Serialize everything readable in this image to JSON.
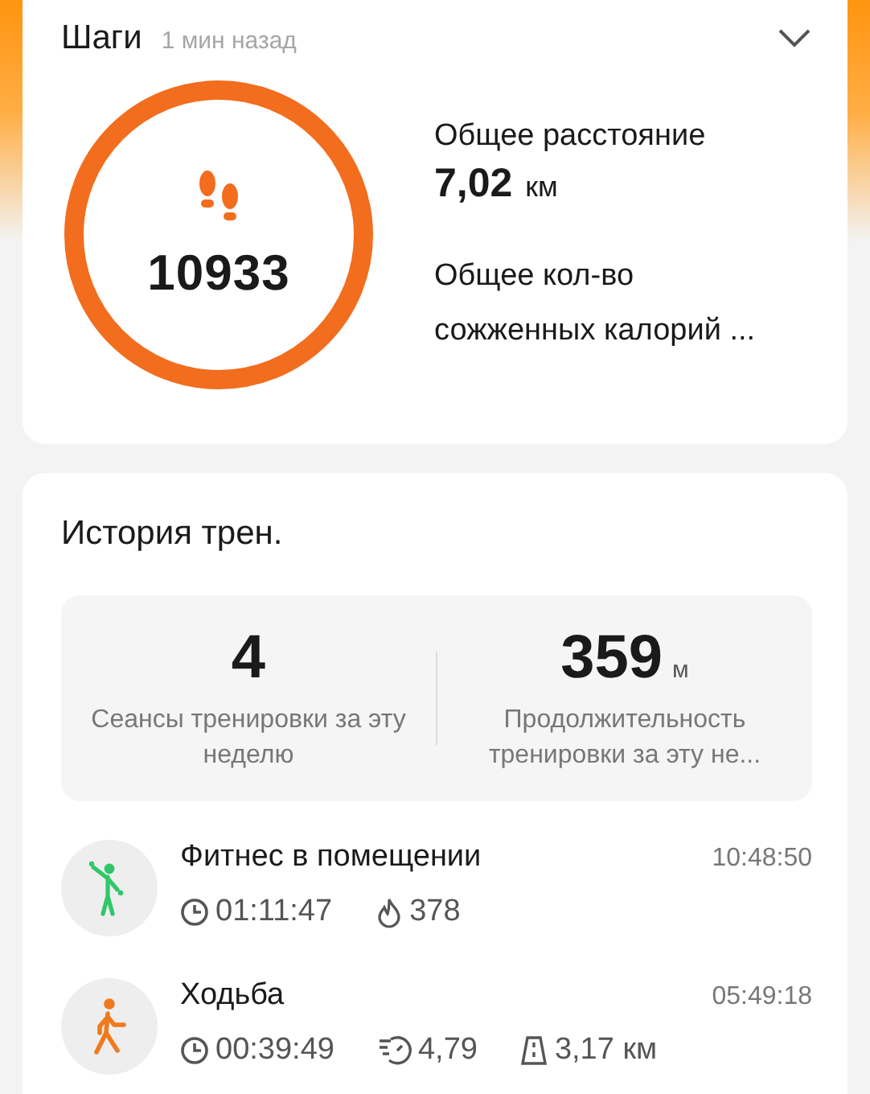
{
  "steps_card": {
    "title": "Шаги",
    "updated": "1 мин назад",
    "expanded": false,
    "steps": "10933",
    "level": 1,
    "distance_label": "Общее расстояние",
    "distance_value": "7,02",
    "distance_unit": "км",
    "calories_label": "Общее кол-во сожженных калорий ..."
  },
  "history": {
    "title": "История трен.",
    "stats": [
      {
        "value": "4",
        "label": "Сеансы тренировки за эту неделю"
      },
      {
        "value": "359",
        "unit": "м",
        "label": "Продолжительность тренировки за эту не..."
      }
    ],
    "workouts": [
      {
        "kind": "fitness",
        "name": "Фитнес в помещении",
        "time": "10:48:50",
        "metrics": [
          {
            "kind": "duration",
            "value": "01:11:47"
          },
          {
            "kind": "calories",
            "value": "378"
          }
        ]
      },
      {
        "kind": "walking",
        "name": "Ходьба",
        "time": "05:49:18",
        "metrics": [
          {
            "kind": "duration",
            "value": "00:39:49"
          },
          {
            "kind": "pace",
            "value": "4,79"
          },
          {
            "kind": "distance",
            "value": "3,17 км"
          }
        ]
      }
    ]
  }
}
